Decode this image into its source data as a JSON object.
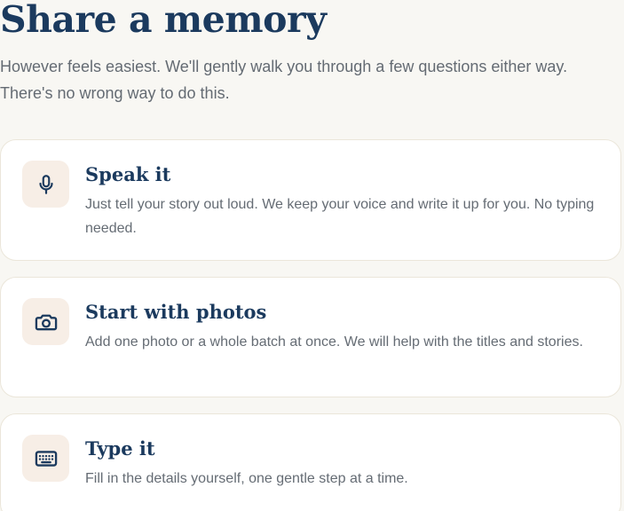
{
  "page": {
    "title": "Share a memory",
    "intro": "However feels easiest. We'll gently walk you through a few questions either way. There's no wrong way to do this."
  },
  "options": [
    {
      "title": "Speak it",
      "description": "Just tell your story out loud. We keep your voice and write it up for you. No typing needed.",
      "icon": "microphone-icon"
    },
    {
      "title": "Start with photos",
      "description": "Add one photo or a whole batch at once. We will help with the titles and stories.",
      "icon": "camera-icon"
    },
    {
      "title": "Type it",
      "description": "Fill in the details yourself, one gentle step at a time.",
      "icon": "keyboard-icon"
    }
  ],
  "colors": {
    "background": "#f8f7f3",
    "heading": "#1b3a5e",
    "body_text": "#656c74",
    "icon_tile": "#f7eee6",
    "card_border": "#ebe6da"
  }
}
